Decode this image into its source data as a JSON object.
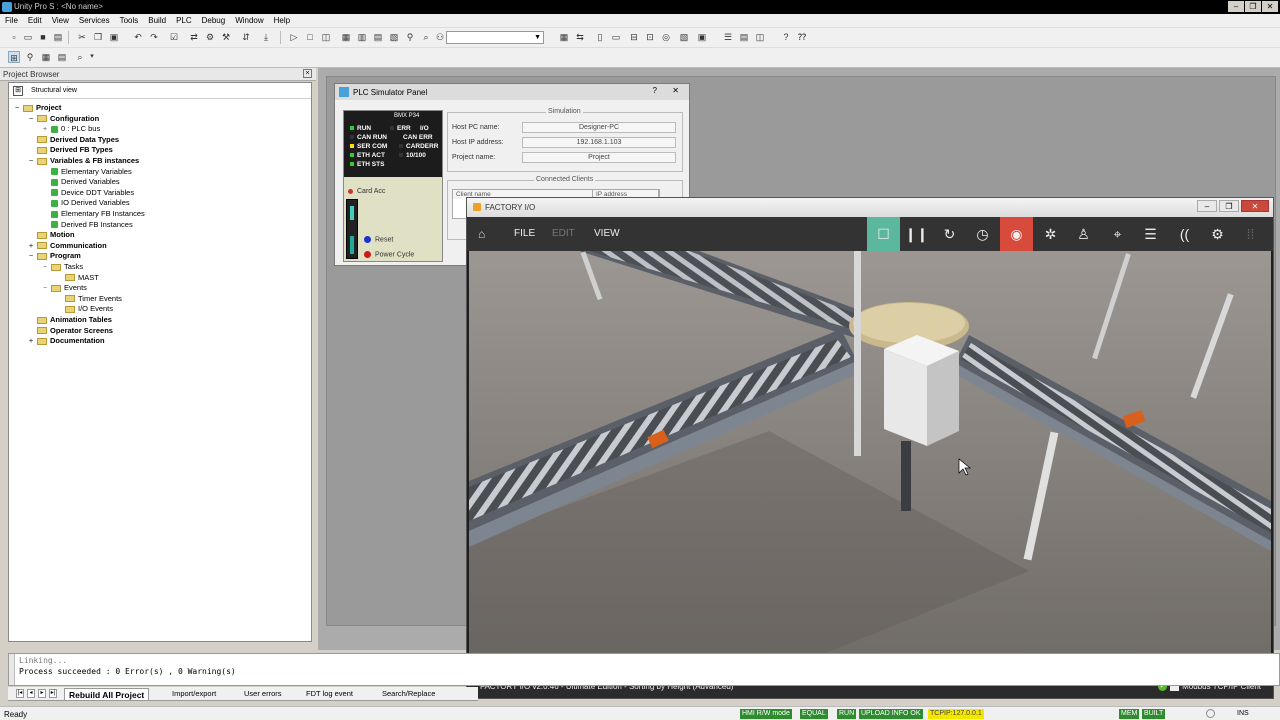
{
  "window": {
    "title": "Unity Pro S : <No name>",
    "controls": [
      "–",
      "❐",
      "✕"
    ]
  },
  "menu": [
    "File",
    "Edit",
    "View",
    "Services",
    "Tools",
    "Build",
    "PLC",
    "Debug",
    "Window",
    "Help"
  ],
  "project_browser": {
    "header": "Project Browser",
    "view_label": "Structural view",
    "tree": [
      {
        "label": "Project",
        "bold": true,
        "level": 0,
        "type": "folder",
        "exp": "−"
      },
      {
        "label": "Configuration",
        "bold": true,
        "level": 1,
        "type": "folder",
        "exp": "−"
      },
      {
        "label": "0 : PLC bus",
        "bold": false,
        "level": 2,
        "type": "item",
        "exp": "+"
      },
      {
        "label": "Derived Data Types",
        "bold": true,
        "level": 1,
        "type": "folder",
        "exp": ""
      },
      {
        "label": "Derived FB Types",
        "bold": true,
        "level": 1,
        "type": "folder",
        "exp": ""
      },
      {
        "label": "Variables & FB instances",
        "bold": true,
        "level": 1,
        "type": "folder",
        "exp": "−"
      },
      {
        "label": "Elementary Variables",
        "bold": false,
        "level": 2,
        "type": "item",
        "exp": ""
      },
      {
        "label": "Derived Variables",
        "bold": false,
        "level": 2,
        "type": "item",
        "exp": ""
      },
      {
        "label": "Device DDT Variables",
        "bold": false,
        "level": 2,
        "type": "item",
        "exp": ""
      },
      {
        "label": "IO Derived Variables",
        "bold": false,
        "level": 2,
        "type": "item",
        "exp": ""
      },
      {
        "label": "Elementary FB Instances",
        "bold": false,
        "level": 2,
        "type": "item",
        "exp": ""
      },
      {
        "label": "Derived FB Instances",
        "bold": false,
        "level": 2,
        "type": "item",
        "exp": ""
      },
      {
        "label": "Motion",
        "bold": true,
        "level": 1,
        "type": "folder",
        "exp": ""
      },
      {
        "label": "Communication",
        "bold": true,
        "level": 1,
        "type": "folder",
        "exp": "+"
      },
      {
        "label": "Program",
        "bold": true,
        "level": 1,
        "type": "folder",
        "exp": "−"
      },
      {
        "label": "Tasks",
        "bold": false,
        "level": 2,
        "type": "folder",
        "exp": "−"
      },
      {
        "label": "MAST",
        "bold": false,
        "level": 3,
        "type": "folder",
        "exp": ""
      },
      {
        "label": "Events",
        "bold": false,
        "level": 2,
        "type": "folder",
        "exp": "−"
      },
      {
        "label": "Timer Events",
        "bold": false,
        "level": 3,
        "type": "folder",
        "exp": ""
      },
      {
        "label": "I/O Events",
        "bold": false,
        "level": 3,
        "type": "folder",
        "exp": ""
      },
      {
        "label": "Animation Tables",
        "bold": true,
        "level": 1,
        "type": "folder",
        "exp": ""
      },
      {
        "label": "Operator Screens",
        "bold": true,
        "level": 1,
        "type": "folder",
        "exp": ""
      },
      {
        "label": "Documentation",
        "bold": true,
        "level": 1,
        "type": "folder",
        "exp": "+"
      }
    ]
  },
  "plc_panel": {
    "title": "PLC Simulator Panel",
    "help": "?",
    "close": "✕",
    "model": "BMX P34",
    "leds": [
      {
        "label": "RUN",
        "color": "#2fcf2f"
      },
      {
        "label": "ERR",
        "color": "#333333"
      },
      {
        "label": "I/O",
        "color": "#333333"
      },
      {
        "label": "CAN RUN",
        "color": "#333333"
      },
      {
        "label": "CAN ERR",
        "color": "#333333"
      },
      {
        "label": "SER COM",
        "color": "#f5e600"
      },
      {
        "label": "CARDERR",
        "color": "#333333"
      },
      {
        "label": "ETH ACT",
        "color": "#2fcf2f"
      },
      {
        "label": "10/100",
        "color": "#333333"
      },
      {
        "label": "ETH STS",
        "color": "#2fcf2f"
      }
    ],
    "card_acc": "Card Acc",
    "reset": "Reset",
    "power_cycle": "Power Cycle",
    "simulation": {
      "title": "Simulation",
      "host_pc_label": "Host PC name:",
      "host_pc_value": "Designer-PC",
      "host_ip_label": "Host IP address:",
      "host_ip_value": "192.168.1.103",
      "project_label": "Project name:",
      "project_value": "Project"
    },
    "clients": {
      "title": "Connected Clients",
      "col_client": "Client name",
      "col_ip": "IP address"
    }
  },
  "factory_io": {
    "title": "FACTORY I/O",
    "menu": {
      "file": "FILE",
      "edit": "EDIT",
      "view": "VIEW"
    },
    "toolbar_icons": [
      "stop-icon",
      "pause-icon",
      "reset-icon",
      "timer-icon",
      "camera-icon",
      "fan-icon",
      "person-icon",
      "crosshair-icon",
      "list-icon",
      "signal-icon",
      "settings-icon",
      "grid-icon"
    ],
    "status_left": "FACTORY I/O v2.0.46 - Ultimate Edition - Sorting by Height (Advanced)",
    "status_right": "Modbus TCP/IP Client",
    "colors": {
      "active_green": "#5bb89e",
      "active_red": "#d84a3c"
    }
  },
  "output": {
    "line1": "Linking...",
    "line2": "Process succeeded : 0 Error(s) , 0 Warning(s)"
  },
  "output_tabs": [
    "Rebuild All Project",
    "Import/export",
    "User errors",
    "FDT log event",
    "Search/Replace"
  ],
  "status_bar": {
    "ready": "Ready",
    "hmi": "HMI R/W mode",
    "equal": "EQUAL",
    "run": "RUN",
    "upload": "UPLOAD INFO OK",
    "tcpip": "TCPIP:127.0.0.1",
    "mem": "MEM",
    "built": "BUILT",
    "ins": "INS"
  }
}
